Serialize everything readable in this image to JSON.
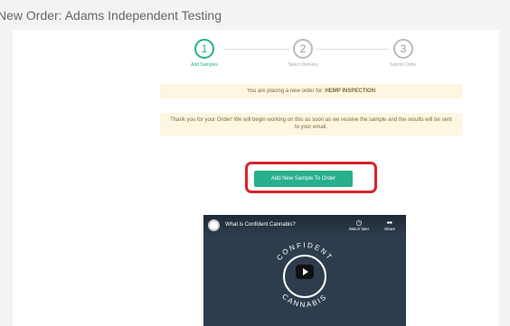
{
  "header": {
    "title": "New Order: Adams Independent Testing"
  },
  "steps": [
    {
      "number": "1",
      "label": "Add Samples",
      "active": true
    },
    {
      "number": "2",
      "label": "Select Delivery",
      "active": false
    },
    {
      "number": "3",
      "label": "Submit Order",
      "active": false
    }
  ],
  "notices": {
    "order_prefix": "You are placing a new order for:",
    "order_type": "HEMP INSPECTION",
    "thank_you": "Thank you for your Order! We will begin working on this as soon as we receive the sample and the results will be sent to your email."
  },
  "actions": {
    "add_sample_label": "Add New Sample To Order"
  },
  "video": {
    "title": "What is Confident Cannabis?",
    "watch_later": "Watch later",
    "share": "Share",
    "logo_top": "CONFIDENT",
    "logo_bottom": "CANNABIS"
  },
  "colors": {
    "accent": "#27b08b",
    "highlight": "#d9232d",
    "notice_bg": "#fdf6e0",
    "video_bg": "#2e3d4d"
  }
}
